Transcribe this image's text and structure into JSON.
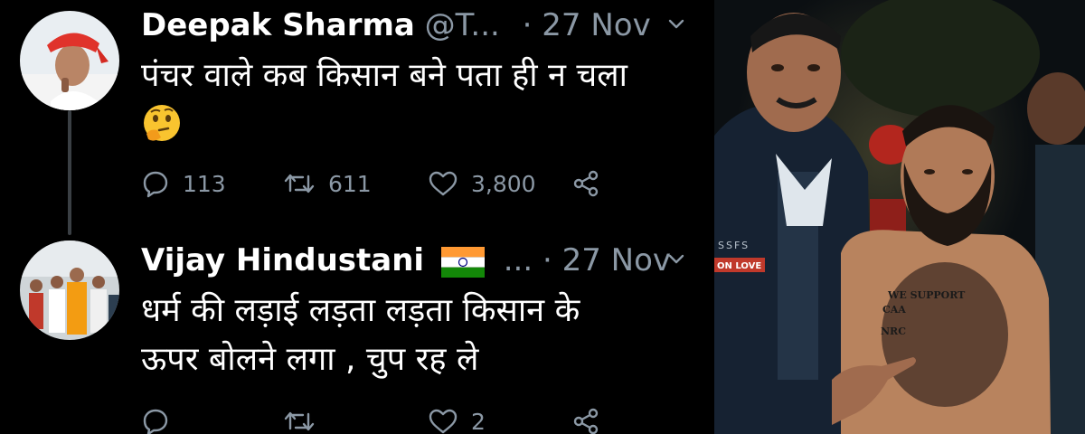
{
  "tweets": [
    {
      "name": "Deepak Sharma",
      "handle": "@T...",
      "separator": "·",
      "date": "27 Nov",
      "text": "पंचर वाले कब किसान बने पता ही न चला",
      "emoji": "thinking-face-emoji",
      "replies": "113",
      "retweets": "611",
      "likes": "3,800"
    },
    {
      "name": "Vijay Hindustani",
      "flag": "india-flag-emoji",
      "handle": "...",
      "separator": "·",
      "date": "27 Nov",
      "text_line1": "धर्म की लड़ाई लड़ता लड़ता किसान के",
      "text_line2": "ऊपर बोलने लगा , चुप रह ले",
      "replies": "",
      "retweets": "",
      "likes": "2"
    }
  ],
  "photo": {
    "chest_line1": "WE SUPPORT",
    "chest_line2": "CAA",
    "chest_line3": "NRC",
    "jacket_text": "SSFS",
    "badge_text": "ON LOVE"
  },
  "colors": {
    "background": "#000000",
    "secondary_text": "#8b98a5",
    "thread_line": "#3a3f44"
  }
}
